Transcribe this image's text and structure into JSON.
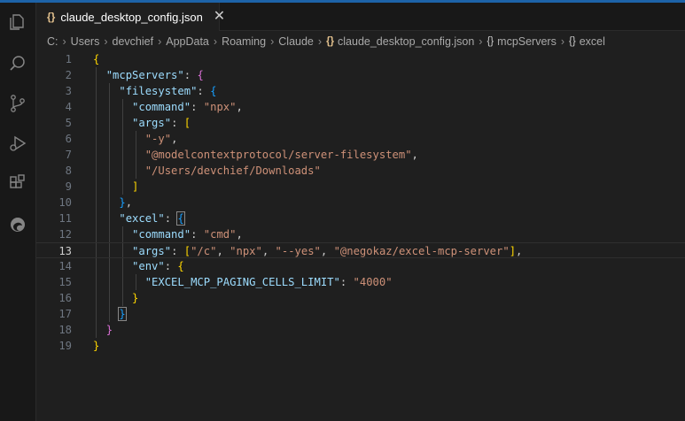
{
  "tab": {
    "filename": "claude_desktop_config.json",
    "close_glyph": "✕"
  },
  "breadcrumb": [
    "C:",
    "Users",
    "devchief",
    "AppData",
    "Roaming",
    "Claude",
    "claude_desktop_config.json",
    "mcpServers",
    "excel"
  ],
  "active_line": 13,
  "colors": {
    "key": "#9cdcfe",
    "string": "#ce9178",
    "bracket_level1": "#ffd700",
    "bracket_level2": "#da70d6",
    "bracket_level3": "#179fff",
    "accent": "#1d63a8"
  },
  "activity_icons": [
    "explorer-icon",
    "search-icon",
    "source-control-icon",
    "run-debug-icon",
    "extensions-icon",
    "edge-icon"
  ],
  "code_lines": [
    [
      [
        "b1",
        "{"
      ]
    ],
    [
      [
        "p",
        "  "
      ],
      [
        "k",
        "\"mcpServers\""
      ],
      [
        "p",
        ": "
      ],
      [
        "b2",
        "{"
      ]
    ],
    [
      [
        "p",
        "    "
      ],
      [
        "k",
        "\"filesystem\""
      ],
      [
        "p",
        ": "
      ],
      [
        "b3",
        "{"
      ]
    ],
    [
      [
        "p",
        "      "
      ],
      [
        "k",
        "\"command\""
      ],
      [
        "p",
        ": "
      ],
      [
        "s",
        "\"npx\""
      ],
      [
        "p",
        ","
      ]
    ],
    [
      [
        "p",
        "      "
      ],
      [
        "k",
        "\"args\""
      ],
      [
        "p",
        ": "
      ],
      [
        "b1",
        "["
      ]
    ],
    [
      [
        "p",
        "        "
      ],
      [
        "s",
        "\"-y\""
      ],
      [
        "p",
        ","
      ]
    ],
    [
      [
        "p",
        "        "
      ],
      [
        "s",
        "\"@modelcontextprotocol/server-filesystem\""
      ],
      [
        "p",
        ","
      ]
    ],
    [
      [
        "p",
        "        "
      ],
      [
        "s",
        "\"/Users/devchief/Downloads\""
      ]
    ],
    [
      [
        "p",
        "      "
      ],
      [
        "b1",
        "]"
      ]
    ],
    [
      [
        "p",
        "    "
      ],
      [
        "b3",
        "}"
      ],
      [
        "p",
        ","
      ]
    ],
    [
      [
        "p",
        "    "
      ],
      [
        "k",
        "\"excel\""
      ],
      [
        "p",
        ": "
      ],
      [
        "b3 hl",
        "{"
      ]
    ],
    [
      [
        "p",
        "      "
      ],
      [
        "k",
        "\"command\""
      ],
      [
        "p",
        ": "
      ],
      [
        "s",
        "\"cmd\""
      ],
      [
        "p",
        ","
      ]
    ],
    [
      [
        "p",
        "      "
      ],
      [
        "k",
        "\"args\""
      ],
      [
        "p",
        ": "
      ],
      [
        "b1",
        "["
      ],
      [
        "s",
        "\"/c\""
      ],
      [
        "p",
        ", "
      ],
      [
        "s",
        "\"npx\""
      ],
      [
        "p",
        ", "
      ],
      [
        "s",
        "\"--yes\""
      ],
      [
        "p",
        ", "
      ],
      [
        "s",
        "\"@negokaz/excel-mcp-server\""
      ],
      [
        "b1",
        "]"
      ],
      [
        "p",
        ","
      ]
    ],
    [
      [
        "p",
        "      "
      ],
      [
        "k",
        "\"env\""
      ],
      [
        "p",
        ": "
      ],
      [
        "b1",
        "{"
      ]
    ],
    [
      [
        "p",
        "        "
      ],
      [
        "k",
        "\"EXCEL_MCP_PAGING_CELLS_LIMIT\""
      ],
      [
        "p",
        ": "
      ],
      [
        "s",
        "\"4000\""
      ]
    ],
    [
      [
        "p",
        "      "
      ],
      [
        "b1",
        "}"
      ]
    ],
    [
      [
        "p",
        "    "
      ],
      [
        "b3 hl",
        "}"
      ]
    ],
    [
      [
        "p",
        "  "
      ],
      [
        "b2",
        "}"
      ]
    ],
    [
      [
        "b1",
        "}"
      ]
    ]
  ]
}
